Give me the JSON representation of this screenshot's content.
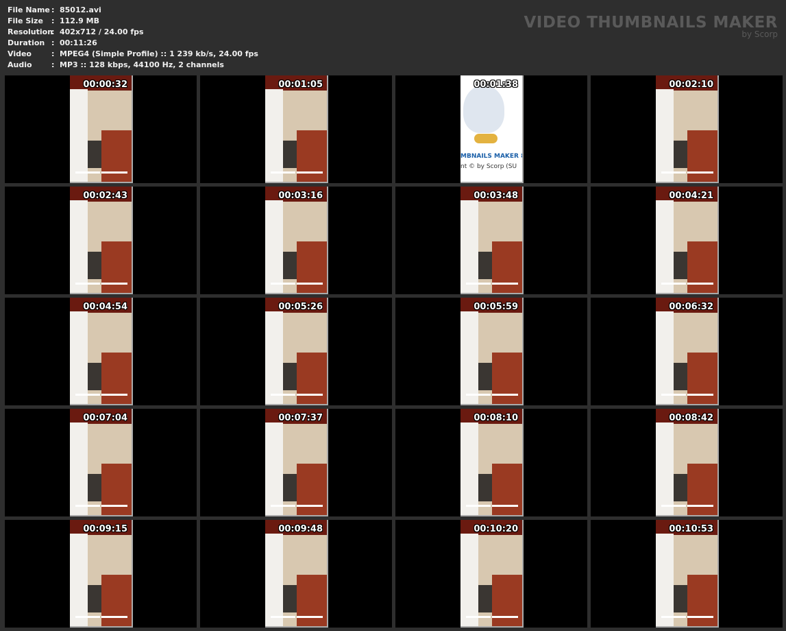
{
  "info": [
    {
      "label": "File Name",
      "value": "85012.avi"
    },
    {
      "label": "File Size",
      "value": "112.9 MB"
    },
    {
      "label": "Resolution",
      "value": "402x712 / 24.00 fps"
    },
    {
      "label": "Duration",
      "value": "00:11:26"
    },
    {
      "label": "Video",
      "value": "MPEG4 (Simple Profile) :: 1 239 kb/s, 24.00 fps"
    },
    {
      "label": "Audio",
      "value": "MP3 :: 128 kbps, 44100 Hz, 2 channels"
    }
  ],
  "separator": ":",
  "logo": {
    "title": "VIDEO THUMBNAILS MAKER",
    "subtitle": "by Scorp"
  },
  "logo_frame": {
    "line1": "MBNAILS MAKER 8",
    "line2": "nt © by Scorp (SU"
  },
  "thumbnails": [
    "00:00:32",
    "00:01:05",
    "00:01:38",
    "00:02:10",
    "00:02:43",
    "00:03:16",
    "00:03:48",
    "00:04:21",
    "00:04:54",
    "00:05:26",
    "00:05:59",
    "00:06:32",
    "00:07:04",
    "00:07:37",
    "00:08:10",
    "00:08:42",
    "00:09:15",
    "00:09:48",
    "00:10:20",
    "00:10:53"
  ],
  "logo_frame_index": 2
}
